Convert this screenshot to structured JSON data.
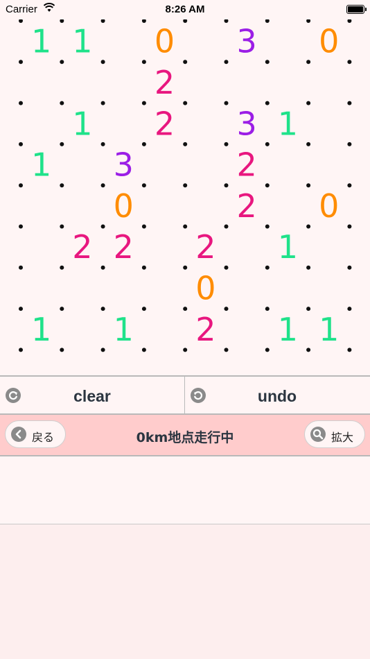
{
  "status_bar": {
    "carrier": "Carrier",
    "time": "8:26 AM",
    "battery_level": 1.0
  },
  "puzzle": {
    "dot_color": "#111111",
    "colors": {
      "0": "#ff8c00",
      "1": "#1fe28a",
      "2": "#e8177f",
      "3": "#9b1ee6"
    },
    "grid": [
      [
        "1",
        "1",
        null,
        "0",
        null,
        "3",
        null,
        "0"
      ],
      [
        null,
        null,
        null,
        "2",
        null,
        null,
        null,
        null
      ],
      [
        null,
        "1",
        null,
        "2",
        null,
        "3",
        "1",
        null
      ],
      [
        "1",
        null,
        "3",
        null,
        null,
        "2",
        null,
        null
      ],
      [
        null,
        null,
        "0",
        null,
        null,
        "2",
        null,
        "0"
      ],
      [
        null,
        "2",
        "2",
        null,
        "2",
        null,
        "1",
        null
      ],
      [
        null,
        null,
        null,
        null,
        "0",
        null,
        null,
        null
      ],
      [
        "1",
        null,
        "1",
        null,
        "2",
        null,
        "1",
        "1"
      ]
    ]
  },
  "actions": {
    "clear_label": "clear",
    "undo_label": "undo"
  },
  "nav": {
    "back_label": "戻る",
    "title": "0km地点走行中",
    "zoom_label": "拡大"
  }
}
